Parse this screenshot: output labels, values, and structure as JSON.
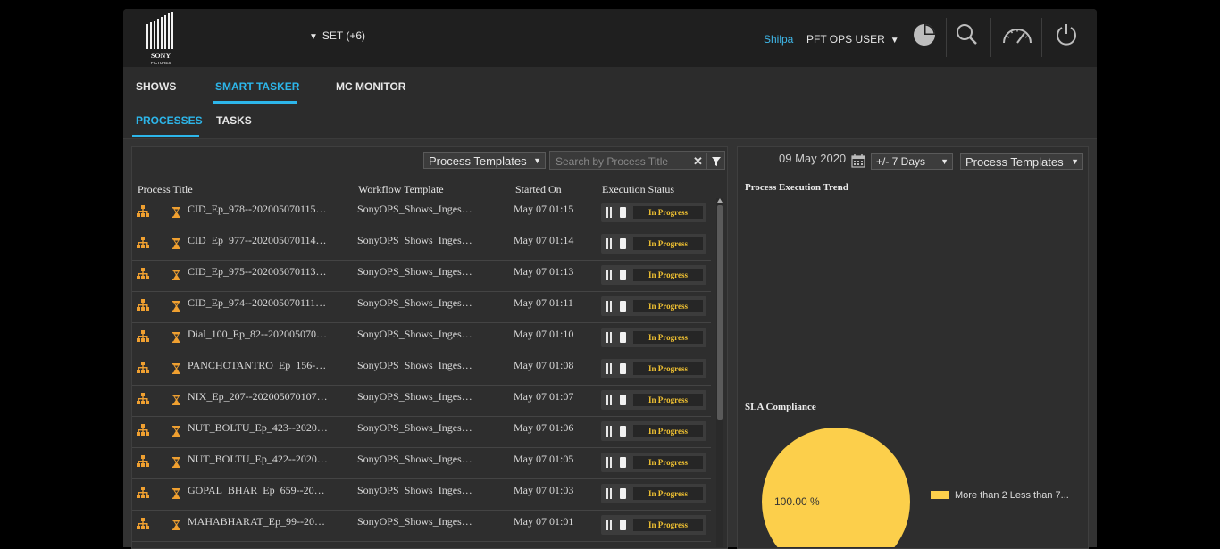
{
  "header": {
    "brand_line1": "SONY",
    "brand_line2": "PICTURES",
    "set_label": "SET (+6)",
    "user_name": "Shilpa",
    "user_role": "PFT OPS USER"
  },
  "icons": [
    "pie-chart-icon",
    "search-icon",
    "dashboard-gauge-icon",
    "power-icon",
    "calendar-icon",
    "filter-icon",
    "hierarchy-icon",
    "hourglass-icon"
  ],
  "main_tabs": [
    {
      "label": "SHOWS",
      "active": false
    },
    {
      "label": "SMART TASKER",
      "active": true
    },
    {
      "label": "MC MONITOR",
      "active": false
    }
  ],
  "sub_tabs": [
    {
      "label": "PROCESSES",
      "active": true
    },
    {
      "label": "TASKS",
      "active": false
    }
  ],
  "left_panel": {
    "template_dropdown": "Process Templates",
    "search_placeholder": "Search by Process Title",
    "clear_label": "✕",
    "columns": [
      "Process Title",
      "Workflow Template",
      "Started On",
      "Execution Status"
    ],
    "rows": [
      {
        "title": "CID_Ep_978--202005070115…",
        "workflow": "SonyOPS_Shows_Inges…",
        "started": "May 07 01:15",
        "status": "In Progress"
      },
      {
        "title": "CID_Ep_977--202005070114…",
        "workflow": "SonyOPS_Shows_Inges…",
        "started": "May 07 01:14",
        "status": "In Progress"
      },
      {
        "title": "CID_Ep_975--202005070113…",
        "workflow": "SonyOPS_Shows_Inges…",
        "started": "May 07 01:13",
        "status": "In Progress"
      },
      {
        "title": "CID_Ep_974--202005070111…",
        "workflow": "SonyOPS_Shows_Inges…",
        "started": "May 07 01:11",
        "status": "In Progress"
      },
      {
        "title": "Dial_100_Ep_82--202005070…",
        "workflow": "SonyOPS_Shows_Inges…",
        "started": "May 07 01:10",
        "status": "In Progress"
      },
      {
        "title": "PANCHOTANTRO_Ep_156-…",
        "workflow": "SonyOPS_Shows_Inges…",
        "started": "May 07 01:08",
        "status": "In Progress"
      },
      {
        "title": "NIX_Ep_207--202005070107…",
        "workflow": "SonyOPS_Shows_Inges…",
        "started": "May 07 01:07",
        "status": "In Progress"
      },
      {
        "title": "NUT_BOLTU_Ep_423--2020…",
        "workflow": "SonyOPS_Shows_Inges…",
        "started": "May 07 01:06",
        "status": "In Progress"
      },
      {
        "title": "NUT_BOLTU_Ep_422--2020…",
        "workflow": "SonyOPS_Shows_Inges…",
        "started": "May 07 01:05",
        "status": "In Progress"
      },
      {
        "title": "GOPAL_BHAR_Ep_659--20…",
        "workflow": "SonyOPS_Shows_Inges…",
        "started": "May 07 01:03",
        "status": "In Progress"
      },
      {
        "title": "MAHABHARAT_Ep_99--20…",
        "workflow": "SonyOPS_Shows_Inges…",
        "started": "May 07 01:01",
        "status": "In Progress"
      }
    ]
  },
  "right_panel": {
    "date": "09 May 2020",
    "range_dropdown": "+/- 7 Days",
    "template_dropdown": "Process Templates",
    "trend_title": "Process Execution Trend",
    "sla_title": "SLA Compliance"
  },
  "colors": {
    "accent": "#2db6ea",
    "pie": "#fccf4b",
    "status_text": "#f1c232",
    "process_icon": "#f0a030"
  },
  "chart_data": {
    "type": "pie",
    "title": "SLA Compliance",
    "slices": [
      {
        "label": "More than 2 Less than 7...",
        "value": 100.0,
        "display": "100.00 %"
      }
    ],
    "legend_position": "right"
  }
}
